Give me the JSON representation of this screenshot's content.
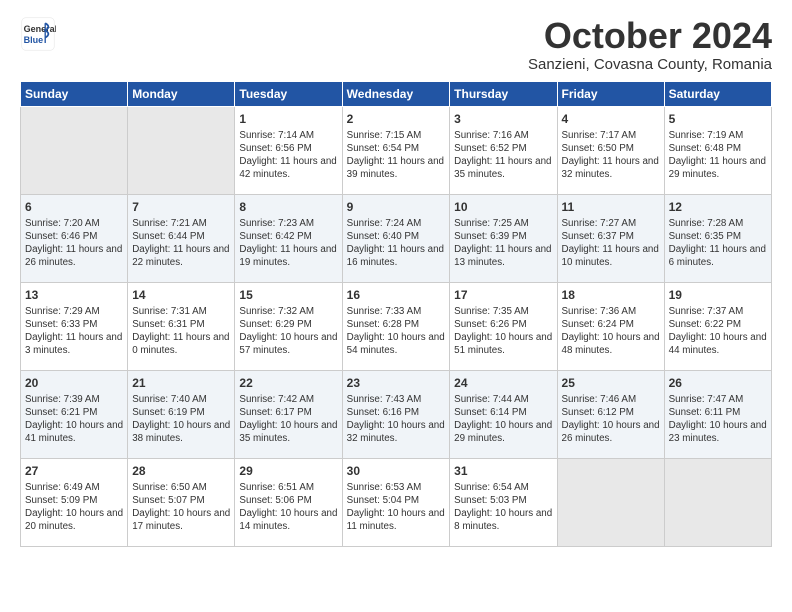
{
  "logo": {
    "general": "General",
    "blue": "Blue"
  },
  "title": "October 2024",
  "location": "Sanzieni, Covasna County, Romania",
  "days_of_week": [
    "Sunday",
    "Monday",
    "Tuesday",
    "Wednesday",
    "Thursday",
    "Friday",
    "Saturday"
  ],
  "weeks": [
    [
      {
        "day": "",
        "empty": true
      },
      {
        "day": "",
        "empty": true
      },
      {
        "day": "1",
        "sunrise": "Sunrise: 7:14 AM",
        "sunset": "Sunset: 6:56 PM",
        "daylight": "Daylight: 11 hours and 42 minutes."
      },
      {
        "day": "2",
        "sunrise": "Sunrise: 7:15 AM",
        "sunset": "Sunset: 6:54 PM",
        "daylight": "Daylight: 11 hours and 39 minutes."
      },
      {
        "day": "3",
        "sunrise": "Sunrise: 7:16 AM",
        "sunset": "Sunset: 6:52 PM",
        "daylight": "Daylight: 11 hours and 35 minutes."
      },
      {
        "day": "4",
        "sunrise": "Sunrise: 7:17 AM",
        "sunset": "Sunset: 6:50 PM",
        "daylight": "Daylight: 11 hours and 32 minutes."
      },
      {
        "day": "5",
        "sunrise": "Sunrise: 7:19 AM",
        "sunset": "Sunset: 6:48 PM",
        "daylight": "Daylight: 11 hours and 29 minutes."
      }
    ],
    [
      {
        "day": "6",
        "sunrise": "Sunrise: 7:20 AM",
        "sunset": "Sunset: 6:46 PM",
        "daylight": "Daylight: 11 hours and 26 minutes."
      },
      {
        "day": "7",
        "sunrise": "Sunrise: 7:21 AM",
        "sunset": "Sunset: 6:44 PM",
        "daylight": "Daylight: 11 hours and 22 minutes."
      },
      {
        "day": "8",
        "sunrise": "Sunrise: 7:23 AM",
        "sunset": "Sunset: 6:42 PM",
        "daylight": "Daylight: 11 hours and 19 minutes."
      },
      {
        "day": "9",
        "sunrise": "Sunrise: 7:24 AM",
        "sunset": "Sunset: 6:40 PM",
        "daylight": "Daylight: 11 hours and 16 minutes."
      },
      {
        "day": "10",
        "sunrise": "Sunrise: 7:25 AM",
        "sunset": "Sunset: 6:39 PM",
        "daylight": "Daylight: 11 hours and 13 minutes."
      },
      {
        "day": "11",
        "sunrise": "Sunrise: 7:27 AM",
        "sunset": "Sunset: 6:37 PM",
        "daylight": "Daylight: 11 hours and 10 minutes."
      },
      {
        "day": "12",
        "sunrise": "Sunrise: 7:28 AM",
        "sunset": "Sunset: 6:35 PM",
        "daylight": "Daylight: 11 hours and 6 minutes."
      }
    ],
    [
      {
        "day": "13",
        "sunrise": "Sunrise: 7:29 AM",
        "sunset": "Sunset: 6:33 PM",
        "daylight": "Daylight: 11 hours and 3 minutes."
      },
      {
        "day": "14",
        "sunrise": "Sunrise: 7:31 AM",
        "sunset": "Sunset: 6:31 PM",
        "daylight": "Daylight: 11 hours and 0 minutes."
      },
      {
        "day": "15",
        "sunrise": "Sunrise: 7:32 AM",
        "sunset": "Sunset: 6:29 PM",
        "daylight": "Daylight: 10 hours and 57 minutes."
      },
      {
        "day": "16",
        "sunrise": "Sunrise: 7:33 AM",
        "sunset": "Sunset: 6:28 PM",
        "daylight": "Daylight: 10 hours and 54 minutes."
      },
      {
        "day": "17",
        "sunrise": "Sunrise: 7:35 AM",
        "sunset": "Sunset: 6:26 PM",
        "daylight": "Daylight: 10 hours and 51 minutes."
      },
      {
        "day": "18",
        "sunrise": "Sunrise: 7:36 AM",
        "sunset": "Sunset: 6:24 PM",
        "daylight": "Daylight: 10 hours and 48 minutes."
      },
      {
        "day": "19",
        "sunrise": "Sunrise: 7:37 AM",
        "sunset": "Sunset: 6:22 PM",
        "daylight": "Daylight: 10 hours and 44 minutes."
      }
    ],
    [
      {
        "day": "20",
        "sunrise": "Sunrise: 7:39 AM",
        "sunset": "Sunset: 6:21 PM",
        "daylight": "Daylight: 10 hours and 41 minutes."
      },
      {
        "day": "21",
        "sunrise": "Sunrise: 7:40 AM",
        "sunset": "Sunset: 6:19 PM",
        "daylight": "Daylight: 10 hours and 38 minutes."
      },
      {
        "day": "22",
        "sunrise": "Sunrise: 7:42 AM",
        "sunset": "Sunset: 6:17 PM",
        "daylight": "Daylight: 10 hours and 35 minutes."
      },
      {
        "day": "23",
        "sunrise": "Sunrise: 7:43 AM",
        "sunset": "Sunset: 6:16 PM",
        "daylight": "Daylight: 10 hours and 32 minutes."
      },
      {
        "day": "24",
        "sunrise": "Sunrise: 7:44 AM",
        "sunset": "Sunset: 6:14 PM",
        "daylight": "Daylight: 10 hours and 29 minutes."
      },
      {
        "day": "25",
        "sunrise": "Sunrise: 7:46 AM",
        "sunset": "Sunset: 6:12 PM",
        "daylight": "Daylight: 10 hours and 26 minutes."
      },
      {
        "day": "26",
        "sunrise": "Sunrise: 7:47 AM",
        "sunset": "Sunset: 6:11 PM",
        "daylight": "Daylight: 10 hours and 23 minutes."
      }
    ],
    [
      {
        "day": "27",
        "sunrise": "Sunrise: 6:49 AM",
        "sunset": "Sunset: 5:09 PM",
        "daylight": "Daylight: 10 hours and 20 minutes."
      },
      {
        "day": "28",
        "sunrise": "Sunrise: 6:50 AM",
        "sunset": "Sunset: 5:07 PM",
        "daylight": "Daylight: 10 hours and 17 minutes."
      },
      {
        "day": "29",
        "sunrise": "Sunrise: 6:51 AM",
        "sunset": "Sunset: 5:06 PM",
        "daylight": "Daylight: 10 hours and 14 minutes."
      },
      {
        "day": "30",
        "sunrise": "Sunrise: 6:53 AM",
        "sunset": "Sunset: 5:04 PM",
        "daylight": "Daylight: 10 hours and 11 minutes."
      },
      {
        "day": "31",
        "sunrise": "Sunrise: 6:54 AM",
        "sunset": "Sunset: 5:03 PM",
        "daylight": "Daylight: 10 hours and 8 minutes."
      },
      {
        "day": "",
        "empty": true
      },
      {
        "day": "",
        "empty": true
      }
    ]
  ]
}
